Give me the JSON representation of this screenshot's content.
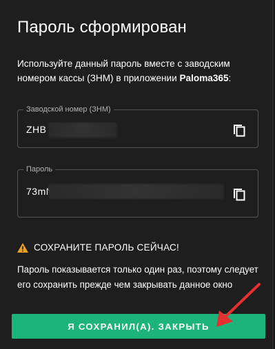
{
  "dialog": {
    "title": "Пароль сформирован",
    "description_pre": "Используйте данный пароль вместе с заводским номером кассы (ЗНМ) в приложении ",
    "description_app": "Paloma365",
    "description_post": ":"
  },
  "serial_field": {
    "label": "Заводской номер (ЗНМ)",
    "value": "ZHB"
  },
  "password_field": {
    "label": "Пароль",
    "value": "73mN"
  },
  "warning": {
    "title": "СОХРАНИТЕ ПАРОЛЬ СЕЙЧАС!",
    "note": "Пароль показывается только один раз, поэтому следует его сохранить прежде чем закрывать данное окно"
  },
  "actions": {
    "close_label": "Я СОХРАНИЛ(А). ЗАКРЫТЬ"
  },
  "icons": {
    "copy": "copy-icon",
    "warning": "warning-triangle-icon",
    "annotation": "red-arrow-annotation"
  },
  "colors": {
    "accent": "#1db47c",
    "warning": "#f0a020",
    "annotation": "#e53030"
  }
}
